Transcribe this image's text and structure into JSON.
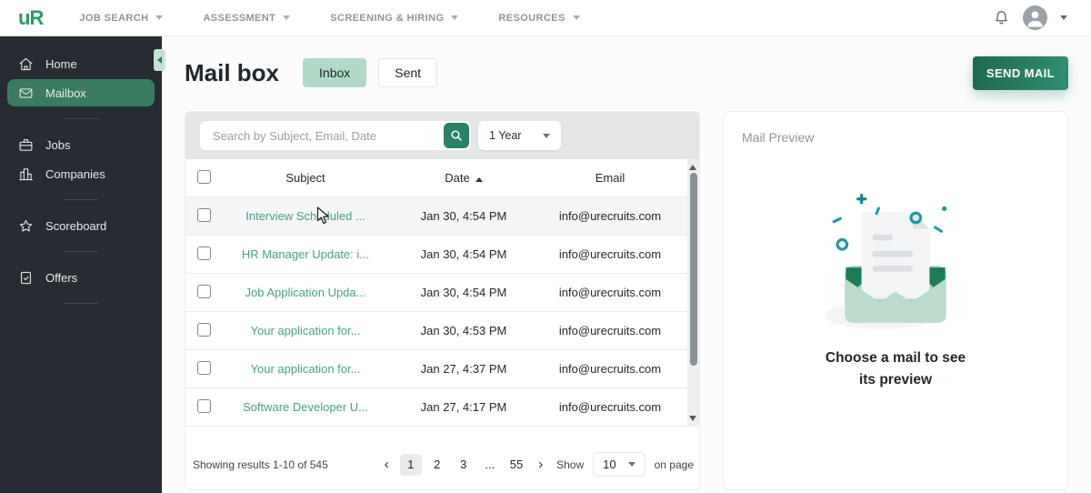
{
  "topnav": {
    "logo_text": "uR",
    "items": [
      {
        "label": "JOB SEARCH"
      },
      {
        "label": "ASSESSMENT"
      },
      {
        "label": "SCREENING & HIRING"
      },
      {
        "label": "RESOURCES"
      }
    ]
  },
  "sidebar": {
    "items": [
      {
        "label": "Home",
        "icon": "home-icon",
        "active": false,
        "divider_after": false
      },
      {
        "label": "Mailbox",
        "icon": "mailbox-icon",
        "active": true,
        "divider_after": true
      },
      {
        "label": "Jobs",
        "icon": "jobs-icon",
        "active": false,
        "divider_after": false
      },
      {
        "label": "Companies",
        "icon": "companies-icon",
        "active": false,
        "divider_after": true
      },
      {
        "label": "Scoreboard",
        "icon": "scoreboard-icon",
        "active": false,
        "divider_after": true
      },
      {
        "label": "Offers",
        "icon": "offers-icon",
        "active": false,
        "divider_after": true
      }
    ]
  },
  "header": {
    "title": "Mail box",
    "tabs": [
      {
        "label": "Inbox",
        "active": true
      },
      {
        "label": "Sent",
        "active": false
      }
    ],
    "send_button_label": "SEND MAIL"
  },
  "toolbar": {
    "search_placeholder": "Search by Subject, Email, Date",
    "period_value": "1 Year"
  },
  "mail_table": {
    "columns": {
      "subject": "Subject",
      "date": "Date",
      "email": "Email"
    },
    "sort": {
      "column": "Date",
      "direction": "asc"
    },
    "rows": [
      {
        "subject": "Interview Scheduled ...",
        "date": "Jan 30, 4:54 PM",
        "email": "info@urecruits.com",
        "highlighted": true
      },
      {
        "subject": "HR Manager Update: i...",
        "date": "Jan 30, 4:54 PM",
        "email": "info@urecruits.com",
        "highlighted": false
      },
      {
        "subject": "Job Application Upda...",
        "date": "Jan 30, 4:54 PM",
        "email": "info@urecruits.com",
        "highlighted": false
      },
      {
        "subject": "Your application for...",
        "date": "Jan 30, 4:53 PM",
        "email": "info@urecruits.com",
        "highlighted": false
      },
      {
        "subject": "Your application for...",
        "date": "Jan 27, 4:37 PM",
        "email": "info@urecruits.com",
        "highlighted": false
      },
      {
        "subject": "Software Developer U...",
        "date": "Jan 27, 4:17 PM",
        "email": "info@urecruits.com",
        "highlighted": false
      }
    ]
  },
  "pagination": {
    "summary": "Showing results 1-10 of 545",
    "prev_label": "‹",
    "next_label": "›",
    "pages": [
      {
        "label": "1",
        "active": true
      },
      {
        "label": "2",
        "active": false
      },
      {
        "label": "3",
        "active": false
      },
      {
        "label": "...",
        "active": false
      },
      {
        "label": "55",
        "active": false
      }
    ],
    "show_label": "Show",
    "per_page_value": "10",
    "on_page_label": "on page"
  },
  "preview": {
    "title": "Mail Preview",
    "empty_message_line1": "Choose a mail to see",
    "empty_message_line2": "its preview"
  },
  "colors": {
    "accent_green": "#2a9c63",
    "sidebar_bg": "#272c33",
    "active_item_bg": "#3b7c61",
    "link_green": "#47a183",
    "inbox_tab_bg": "#b0dac7",
    "send_gradient_start": "#1e6950",
    "send_gradient_end": "#2f8e72",
    "confetti_teal": "#2197a9",
    "envelope_green": "#b7dbc8",
    "envelope_dark_green": "#1e7b56"
  }
}
